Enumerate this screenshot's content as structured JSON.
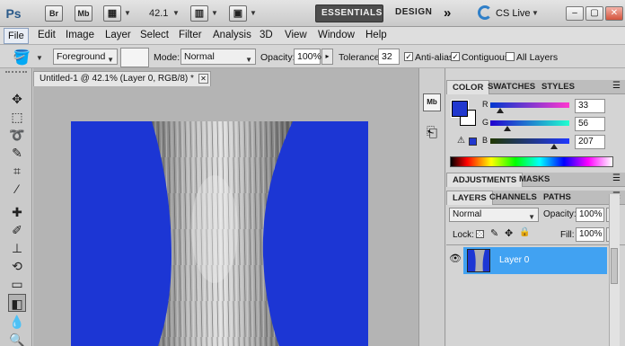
{
  "appbar": {
    "logo": "Ps",
    "br_label": "Br",
    "mb_label": "Mb",
    "zoom": "42.1",
    "essentials": "ESSENTIALS",
    "design": "DESIGN",
    "more": "»",
    "cslive": "CS Live"
  },
  "menu": {
    "items": [
      "File",
      "Edit",
      "Image",
      "Layer",
      "Select",
      "Filter",
      "Analysis",
      "3D",
      "View",
      "Window",
      "Help"
    ]
  },
  "options": {
    "source": "Foreground",
    "mode_label": "Mode:",
    "mode": "Normal",
    "opacity_label": "Opacity:",
    "opacity": "100%",
    "tolerance_label": "Tolerance:",
    "tolerance": "32",
    "antialias_label": "Anti-alias",
    "contiguous_label": "Contiguous",
    "alllayers_label": "All Layers"
  },
  "document": {
    "tab_title": "Untitled-1 @ 42.1% (Layer 0, RGB/8) *",
    "canvas_color": "#1c36d4"
  },
  "color_panel": {
    "tabs": [
      "COLOR",
      "SWATCHES",
      "STYLES"
    ],
    "r_label": "R",
    "g_label": "G",
    "b_label": "B",
    "r": "33",
    "g": "56",
    "b": "207",
    "r_fraction": 0.13,
    "g_fraction": 0.22,
    "b_fraction": 0.81,
    "fg_color": "#2138cf"
  },
  "adjust_panel": {
    "tabs": [
      "ADJUSTMENTS",
      "MASKS"
    ]
  },
  "layers_panel": {
    "tabs": [
      "LAYERS",
      "CHANNELS",
      "PATHS"
    ],
    "blend_mode": "Normal",
    "opacity_label": "Opacity:",
    "opacity": "100%",
    "lock_label": "Lock:",
    "fill_label": "Fill:",
    "fill": "100%",
    "layer_name": "Layer 0"
  }
}
